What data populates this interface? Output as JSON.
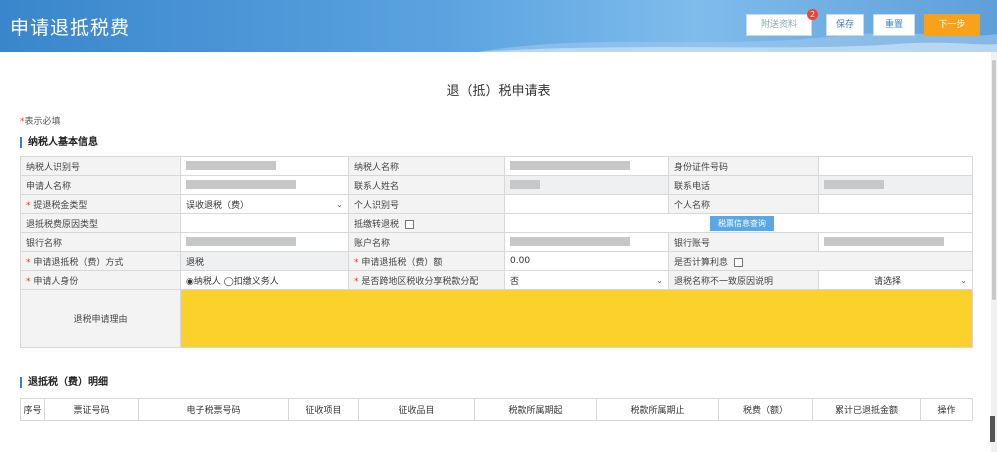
{
  "header": {
    "title": "申请退抵税费",
    "buttons": {
      "attach": "附送资料",
      "attach_badge": "2",
      "save": "保存",
      "reset": "重置",
      "next": "下一步"
    },
    "gradient_colors": [
      "#3a86cc",
      "#7fbcec"
    ]
  },
  "form_title": "退（抵）税申请表",
  "required_note": {
    "star": "*",
    "text": "表示必填"
  },
  "section1": {
    "title": "纳税人基本信息"
  },
  "fields": {
    "taxpayer_id": "纳税人识别号",
    "taxpayer_name": "纳税人名称",
    "id_number": "身份证件号码",
    "applicant_name": "申请人名称",
    "contact_name": "联系人姓名",
    "contact_phone": "联系电话",
    "refund_type": "提退税金类型",
    "refund_type_value": "误收退税（费）",
    "personal_id": "个人识别号",
    "personal_name": "个人名称",
    "refund_voucher_type": "退抵税费原因类型",
    "refund_transfer": "抵缴转退税",
    "tax_query_button": "税票信息查询",
    "bank_name": "银行名称",
    "account_name": "账户名称",
    "bank_account": "银行账号",
    "refund_method": "申请退抵税（费）方式",
    "refund_method_value": "退税",
    "refund_amount": "申请退抵税（费）额",
    "refund_amount_value": "0.00",
    "calc_interest": "是否计算利息",
    "applicant_identity": "申请人身份",
    "identity_taxpayer": "◉纳税人",
    "identity_withholding": "◯扣缴义务人",
    "cross_region": "是否跨地区税收分享税款分配",
    "cross_region_value": "否",
    "name_mismatch": "退税名称不一致原因说明",
    "name_mismatch_value": "请选择",
    "reason": "退税申请理由",
    "reason_bg": "#fdd12c"
  },
  "section2": {
    "title": "退抵税（费）明细"
  },
  "detail_columns": [
    "序号",
    "票证号码",
    "电子税票号码",
    "征收项目",
    "征收品目",
    "税款所属期起",
    "税款所属期止",
    "税费（额）",
    "累计已退抵金额",
    "操作"
  ]
}
